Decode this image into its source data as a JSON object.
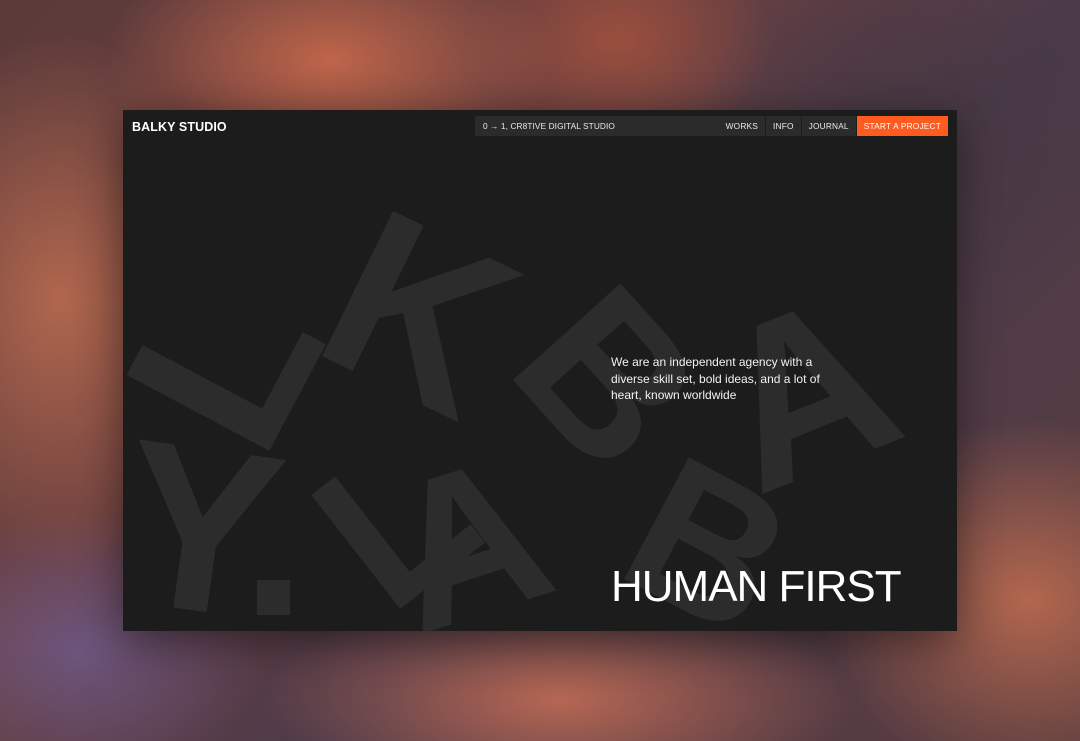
{
  "brand": "BALKY STUDIO",
  "tagline": "0 → 1, CR8TIVE DIGITAL STUDIO",
  "nav": {
    "items": [
      {
        "label": "WORKS"
      },
      {
        "label": "INFO"
      },
      {
        "label": "JOURNAL"
      }
    ],
    "cta": "START A PROJECT"
  },
  "hero": {
    "intro": "We are an independent agency with a diverse skill set, bold ideas, and a lot of heart, known worldwide",
    "headline": "HUMAN FIRST",
    "background_letters": [
      "B",
      "A",
      "L",
      "K",
      "Y",
      ".",
      "L",
      "A",
      "B",
      "A"
    ]
  },
  "colors": {
    "page": "#1c1c1c",
    "nav_bg": "#2b2b2b",
    "accent": "#ff5a1f",
    "text": "#ffffff",
    "letters": "#2c2c2c"
  }
}
